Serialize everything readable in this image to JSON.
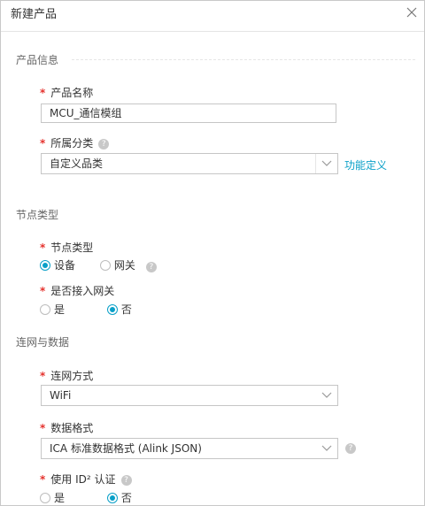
{
  "dialog": {
    "title": "新建产品"
  },
  "sections": {
    "product_info": "产品信息",
    "node_type": "节点类型",
    "network_data": "连网与数据"
  },
  "fields": {
    "product_name": {
      "label": "产品名称",
      "value": "MCU_通信模组"
    },
    "category": {
      "label": "所属分类",
      "value": "自定义品类",
      "link": "功能定义"
    },
    "node_type": {
      "label": "节点类型",
      "options": [
        "设备",
        "网关"
      ],
      "selected": "设备"
    },
    "gateway_access": {
      "label": "是否接入网关",
      "options": [
        "是",
        "否"
      ],
      "selected": "否"
    },
    "network_method": {
      "label": "连网方式",
      "value": "WiFi"
    },
    "data_format": {
      "label": "数据格式",
      "value": "ICA 标准数据格式 (Alink JSON)"
    },
    "id2_auth": {
      "label": "使用 ID² 认证",
      "options": [
        "是",
        "否"
      ],
      "selected": "否"
    }
  },
  "icons": {
    "close": "close-icon",
    "help": "question-circle-icon",
    "caret": "chevron-down-icon"
  },
  "colors": {
    "accent": "#0aa0c8",
    "required": "#e5322d",
    "border": "#c6c6c6"
  }
}
